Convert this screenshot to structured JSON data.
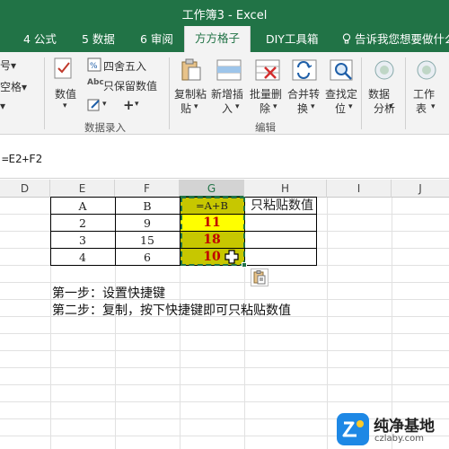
{
  "window": {
    "title": "工作簿3 - Excel"
  },
  "tabs": [
    {
      "label": "4 公式"
    },
    {
      "label": "5 数据"
    },
    {
      "label": "6 审阅"
    },
    {
      "label": "方方格子",
      "active": true
    },
    {
      "label": "DIY工具箱"
    },
    {
      "label": "告诉我您想要做什么"
    }
  ],
  "ribbon": {
    "left_partial": [
      "号▾",
      "空格▾",
      "▾"
    ],
    "numeric_group": {
      "value_label": "数值",
      "round_label": "四舍五入",
      "keep_numeric_label": "只保留数值",
      "group_label": "数据录入"
    },
    "edit_group": {
      "buttons": [
        {
          "line1": "复制粘",
          "line2": "贴"
        },
        {
          "line1": "新增插",
          "line2": "入"
        },
        {
          "line1": "批量删",
          "line2": "除"
        },
        {
          "line1": "合并转",
          "line2": "换"
        },
        {
          "line1": "查找定",
          "line2": "位"
        }
      ],
      "group_label": "编辑"
    },
    "right_buttons": [
      {
        "line1": "数据",
        "line2": "分析"
      },
      {
        "line1": "工作",
        "line2": "表"
      }
    ]
  },
  "formula_bar": {
    "formula": "=E2+F2"
  },
  "grid": {
    "columns": [
      "D",
      "E",
      "F",
      "G",
      "H",
      "I",
      "J"
    ],
    "selected_column": "G",
    "header_row": [
      "A",
      "B",
      "=A+B",
      "只粘贴数值"
    ],
    "rows": [
      {
        "a": "2",
        "b": "9",
        "sum": "11"
      },
      {
        "a": "3",
        "b": "15",
        "sum": "18"
      },
      {
        "a": "4",
        "b": "6",
        "sum": "10"
      }
    ],
    "highlight_color": "#ffff00",
    "selected_fill_color": "#c7c700",
    "sum_text_color": "#c00000"
  },
  "notes": [
    "第一步：设置快捷键",
    "第二步：复制，按下快捷键即可只粘贴数值"
  ],
  "watermark": {
    "name": "纯净基地",
    "url": "czlaby.com"
  },
  "colors": {
    "excel_green": "#217346"
  }
}
